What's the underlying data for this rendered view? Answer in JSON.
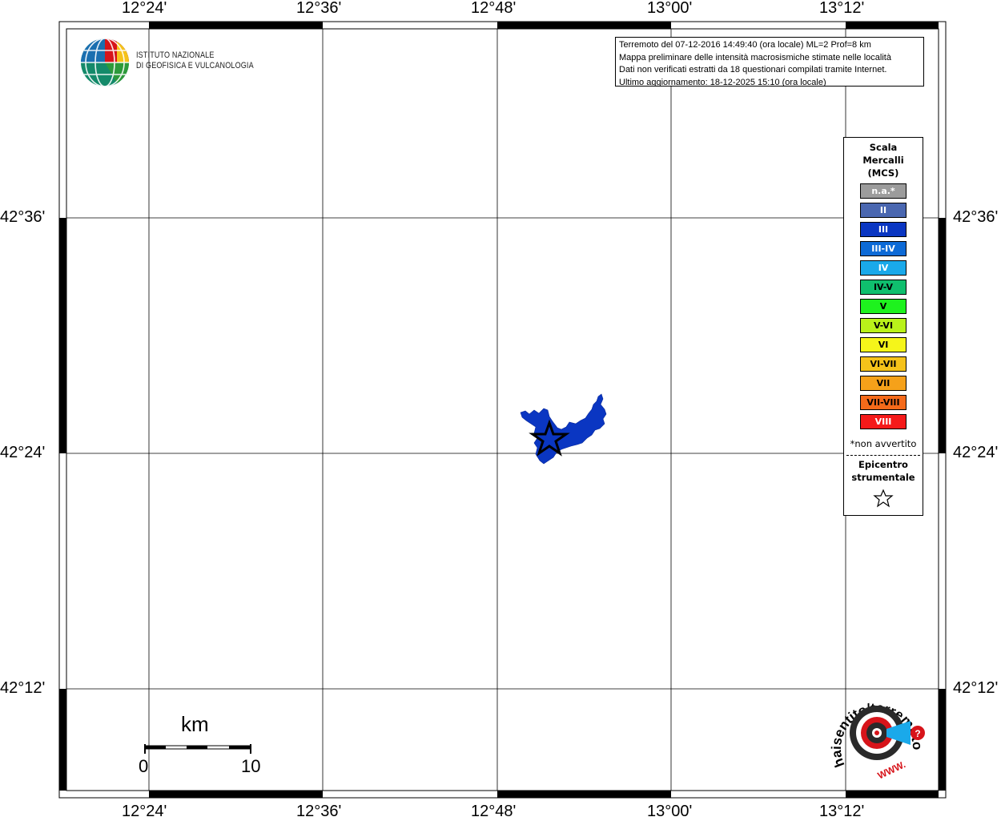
{
  "info": {
    "line1": "Terremoto del 07-12-2016 14:49:40 (ora locale) ML=2 Prof=8 km",
    "line2": "Mappa preliminare delle intensità macrosismiche stimate nelle località",
    "line3": "Dati non verificati estratti da 18 questionari compilati tramite Internet.",
    "line4": "Ultimo aggiornamento: 18-12-2025 15:10 (ora locale)"
  },
  "logo": {
    "line1": "ISTITUTO NAZIONALE",
    "line2": "DI GEOFISICA E VULCANOLOGIA"
  },
  "axes": {
    "lon": [
      "12°24'",
      "12°36'",
      "12°48'",
      "13°00'",
      "13°12'"
    ],
    "lat": [
      "42°36'",
      "42°24'",
      "42°12'"
    ]
  },
  "legend": {
    "title1": "Scala",
    "title2": "Mercalli",
    "title3": "(MCS)",
    "items": [
      {
        "label": "n.a.*",
        "color": "#9c9c9c",
        "text": "#ffffff"
      },
      {
        "label": "II",
        "color": "#4a67b0",
        "text": "#ffffff"
      },
      {
        "label": "III",
        "color": "#0a36c2",
        "text": "#ffffff"
      },
      {
        "label": "III-IV",
        "color": "#0d6ad6",
        "text": "#ffffff"
      },
      {
        "label": "IV",
        "color": "#1aa9ea",
        "text": "#ffffff"
      },
      {
        "label": "IV-V",
        "color": "#0fbf6e",
        "text": "#000000"
      },
      {
        "label": "V",
        "color": "#1ef21e",
        "text": "#000000"
      },
      {
        "label": "V-VI",
        "color": "#b9f21a",
        "text": "#000000"
      },
      {
        "label": "VI",
        "color": "#f5f51a",
        "text": "#000000"
      },
      {
        "label": "VI-VII",
        "color": "#f5c21a",
        "text": "#000000"
      },
      {
        "label": "VII",
        "color": "#f5a11a",
        "text": "#000000"
      },
      {
        "label": "VII-VIII",
        "color": "#f56a1a",
        "text": "#000000"
      },
      {
        "label": "VIII",
        "color": "#f51a1a",
        "text": "#ffffff"
      }
    ],
    "note": "*non avvertito",
    "epi1": "Epicentro",
    "epi2": "strumentale"
  },
  "scalebar": {
    "unit": "km",
    "min": "0",
    "max": "10"
  },
  "hst": {
    "ring": "haisentito/terremoto.it",
    "www": "WWW."
  },
  "colors": {
    "intensity_area": "#0a36c2",
    "frame": "#000000",
    "logo_red": "#d7141a"
  }
}
